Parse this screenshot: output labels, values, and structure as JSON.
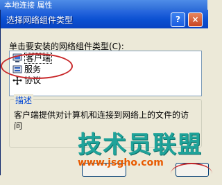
{
  "background_window": {
    "title": "本地连接 属性"
  },
  "dialog": {
    "title": "选择网络组件类型",
    "help_button": "?",
    "close_button": "×",
    "prompt": "单击要安装的网络组件类型(C):",
    "components": [
      {
        "label": "客户端",
        "icon": "client-icon",
        "selected": true
      },
      {
        "label": "服务",
        "icon": "service-icon",
        "selected": false
      },
      {
        "label": "协议",
        "icon": "protocol-icon",
        "selected": false
      }
    ],
    "description": {
      "legend": "描述",
      "text": "客户端提供对计算机和连接到网络上的文件的访问"
    }
  },
  "watermark": {
    "brand": "技术员联盟",
    "url": "www.jsgho.com"
  },
  "colors": {
    "titlebar": "#0a4fd1",
    "highlight_circle": "#c8282a",
    "watermark_text": "#1fa39a",
    "watermark_url": "#e85a00"
  }
}
